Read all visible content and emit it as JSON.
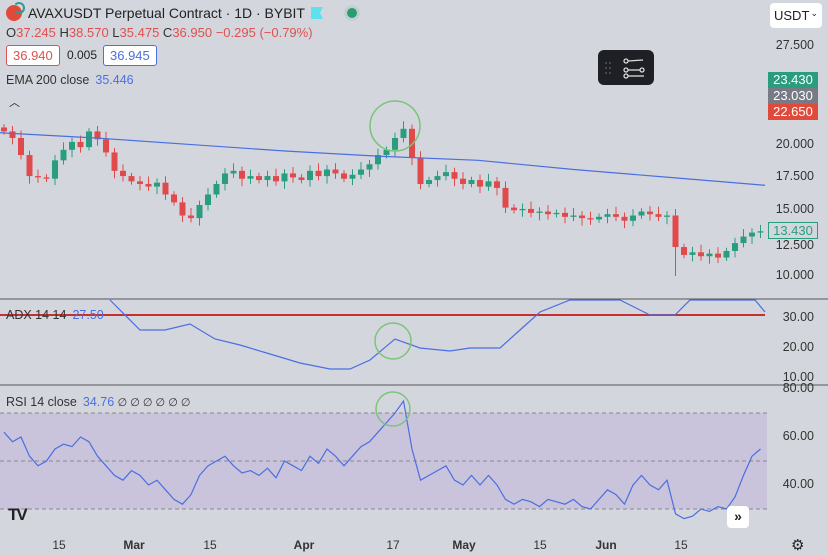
{
  "header": {
    "title": "AVAXUSDT Perpetual Contract · 1D · BYBIT",
    "o_label": "O",
    "o": "37.245",
    "h_label": "H",
    "h": "38.570",
    "l_label": "L",
    "l": "35.475",
    "c_label": "C",
    "c": "36.950",
    "change": "−0.295 (−0.79%)",
    "bid": "36.940",
    "spread": "0.005",
    "ask": "36.945"
  },
  "currency": "USDT",
  "ema": {
    "label": "EMA 200 close",
    "value": "35.446",
    "color": "#4a6fe0",
    "values": [
      20.9,
      20.5,
      20.0,
      19.5,
      19.1,
      18.8,
      18.1,
      17.5,
      16.9
    ]
  },
  "adx": {
    "label": "ADX 14 14",
    "value": "27.50",
    "level": 31,
    "values": [
      [
        110,
        38
      ],
      [
        140,
        26
      ],
      [
        165,
        26
      ],
      [
        190,
        28
      ],
      [
        215,
        23
      ],
      [
        240,
        21
      ],
      [
        270,
        18
      ],
      [
        300,
        15
      ],
      [
        330,
        13
      ],
      [
        350,
        13
      ],
      [
        370,
        16
      ],
      [
        395,
        23
      ],
      [
        420,
        20
      ],
      [
        450,
        19
      ],
      [
        470,
        20
      ],
      [
        500,
        20
      ],
      [
        520,
        26
      ],
      [
        540,
        32
      ],
      [
        570,
        36
      ],
      [
        620,
        36
      ],
      [
        650,
        31
      ],
      [
        675,
        31
      ],
      [
        690,
        36
      ],
      [
        755,
        37
      ],
      [
        765,
        32
      ]
    ],
    "ticks": [
      "30.00",
      "20.00",
      "10.00"
    ]
  },
  "rsi": {
    "label": "RSI 14 close",
    "value": "34.76",
    "extra": "∅ ∅ ∅ ∅ ∅ ∅",
    "ticks": [
      "80.00",
      "60.00",
      "40.00"
    ],
    "values": [
      62,
      58,
      60,
      52,
      48,
      50,
      55,
      57,
      56,
      60,
      58,
      52,
      48,
      44,
      42,
      46,
      44,
      40,
      42,
      38,
      34,
      32,
      36,
      44,
      48,
      50,
      52,
      48,
      45,
      46,
      44,
      47,
      43,
      50,
      48,
      46,
      52,
      49,
      55,
      52,
      48,
      52,
      56,
      58,
      62,
      66,
      70,
      75,
      55,
      42,
      44,
      46,
      48,
      42,
      40,
      44,
      40,
      44,
      40,
      34,
      32,
      34,
      33,
      31,
      34,
      33,
      32,
      34,
      31,
      30,
      34,
      38,
      36,
      32,
      40,
      44,
      40,
      38,
      42,
      28,
      26,
      27,
      30,
      29,
      31,
      30,
      35,
      44,
      52,
      55
    ]
  },
  "price": {
    "ticks": [
      "27.500",
      "20.000",
      "17.500",
      "15.000",
      "12.500",
      "10.000"
    ],
    "tags": [
      {
        "v": "23.430",
        "c": "#2a9d7f"
      },
      {
        "v": "23.030",
        "c": "#787b86"
      },
      {
        "v": "22.650",
        "c": "#e04a3a"
      }
    ],
    "last": "13.430",
    "closes": [
      21.0,
      20.5,
      19.2,
      17.6,
      17.5,
      17.4,
      18.8,
      19.6,
      20.2,
      19.8,
      21.0,
      20.4,
      19.4,
      18.0,
      17.6,
      17.2,
      17.0,
      16.8,
      17.1,
      16.2,
      15.6,
      14.6,
      14.4,
      15.4,
      16.2,
      17.0,
      17.8,
      18.0,
      17.4,
      17.6,
      17.3,
      17.6,
      17.2,
      17.8,
      17.5,
      17.3,
      18.0,
      17.6,
      18.1,
      17.8,
      17.4,
      17.7,
      18.1,
      18.5,
      19.2,
      19.6,
      20.5,
      21.2,
      19.0,
      17.0,
      17.3,
      17.6,
      17.9,
      17.4,
      17.0,
      17.3,
      16.8,
      17.2,
      16.7,
      15.2,
      15.0,
      15.1,
      14.8,
      14.9,
      14.7,
      14.8,
      14.5,
      14.6,
      14.4,
      14.3,
      14.5,
      14.7,
      14.5,
      14.2,
      14.6,
      14.9,
      14.7,
      14.5,
      14.6,
      12.2,
      11.6,
      11.8,
      11.5,
      11.7,
      11.4,
      11.9,
      12.5,
      13.0,
      13.3,
      13.4
    ]
  },
  "xaxis": [
    "15",
    "Mar",
    "15",
    "Apr",
    "17",
    "May",
    "15",
    "Jun",
    "15"
  ],
  "colors": {
    "up": "#2a9d7f",
    "down": "#e04a4a"
  }
}
